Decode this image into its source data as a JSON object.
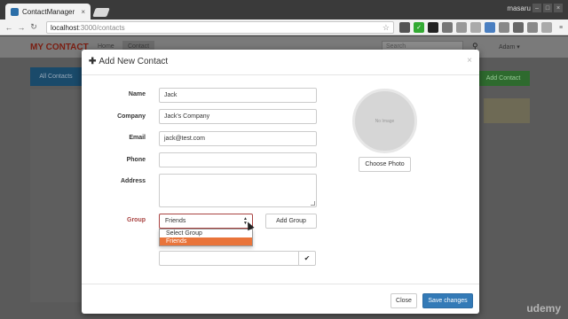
{
  "browser": {
    "tab_title": "ContactManager",
    "tab_close": "×",
    "os_user": "masaru",
    "url_host": "localhost",
    "url_path": ":3000/contacts",
    "back": "←",
    "forward": "→",
    "reload": "↻",
    "star": "☆"
  },
  "navbar": {
    "brand": "MY CONTACT",
    "links": [
      "Home",
      "Contact"
    ],
    "search_placeholder": "Search",
    "user": "Adam ▾"
  },
  "background": {
    "all_contacts": "All Contacts",
    "add_contact": "Add Contact"
  },
  "modal": {
    "title": "Add New Contact",
    "close": "×",
    "fields": {
      "name_label": "Name",
      "name_value": "Jack",
      "company_label": "Company",
      "company_value": "Jack's Company",
      "email_label": "Email",
      "email_value": "jack@test.com",
      "phone_label": "Phone",
      "phone_value": "",
      "address_label": "Address",
      "address_value": "",
      "group_label": "Group",
      "group_selected": "Friends",
      "group_options": [
        "Select Group",
        "Friends"
      ]
    },
    "add_group_button": "Add Group",
    "photo_placeholder": "No Image",
    "choose_photo_button": "Choose Photo",
    "check_icon": "✔",
    "close_button": "Close",
    "save_button": "Save changes"
  },
  "watermark": "udemy",
  "colors": {
    "error": "#a94442",
    "primary": "#337ab7",
    "dropdown_highlight": "#e9743a"
  }
}
